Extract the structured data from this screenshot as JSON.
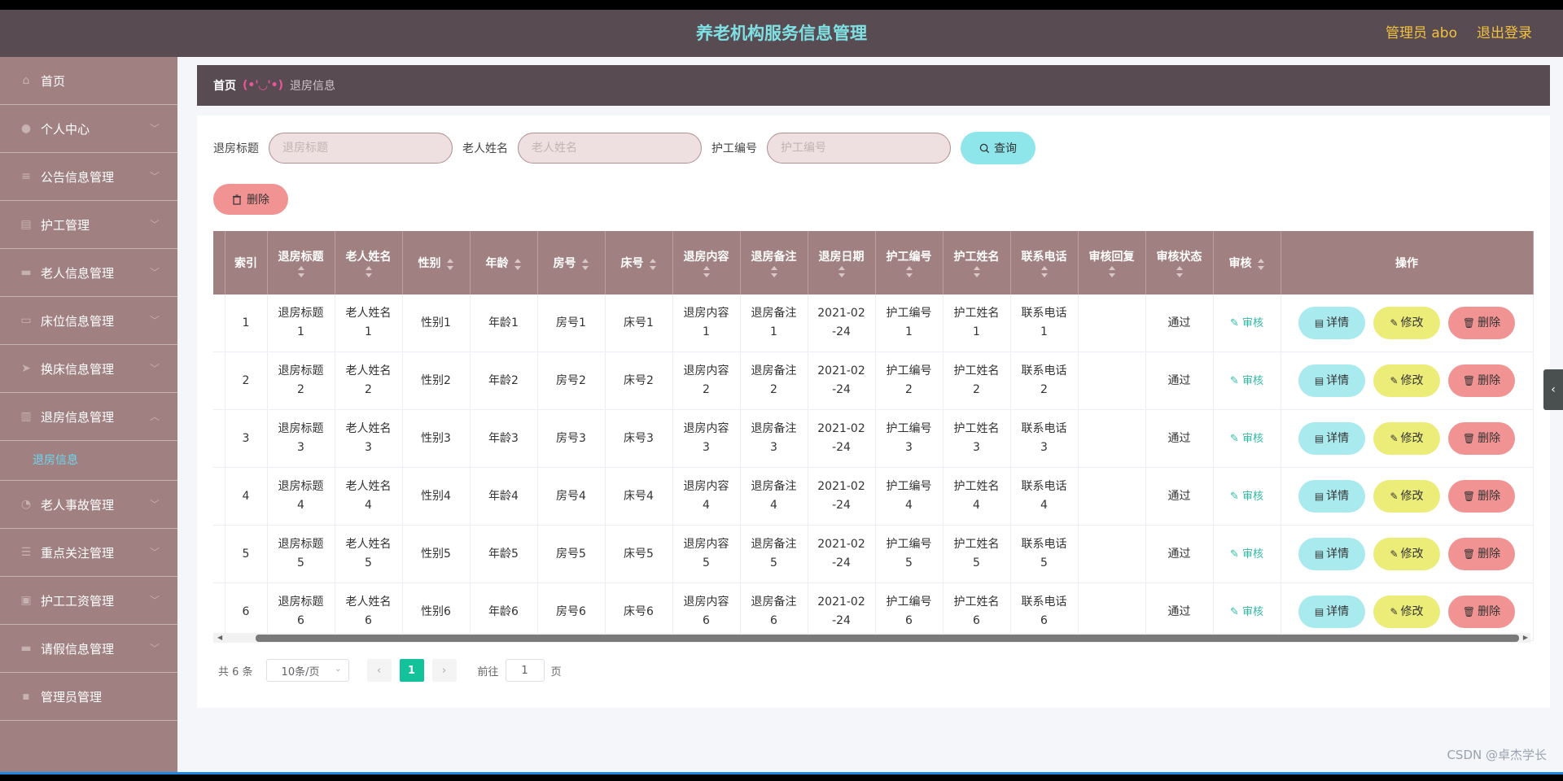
{
  "header": {
    "title": "养老机构服务信息管理",
    "user": "管理员 abo",
    "logout": "退出登录"
  },
  "sidebar": {
    "items": [
      {
        "label": "首页",
        "icon": "home-icon",
        "glyph": "⌂",
        "chevron": false
      },
      {
        "label": "个人中心",
        "icon": "user-icon",
        "glyph": "●",
        "chevron": true
      },
      {
        "label": "公告信息管理",
        "icon": "menu-icon",
        "glyph": "≡",
        "chevron": true
      },
      {
        "label": "护工管理",
        "icon": "list-icon",
        "glyph": "▤",
        "chevron": true
      },
      {
        "label": "老人信息管理",
        "icon": "message-icon",
        "glyph": "▬",
        "chevron": true
      },
      {
        "label": "床位信息管理",
        "icon": "bed-icon",
        "glyph": "▭",
        "chevron": true
      },
      {
        "label": "换床信息管理",
        "icon": "send-icon",
        "glyph": "➤",
        "chevron": true
      },
      {
        "label": "退房信息管理",
        "icon": "document-icon",
        "glyph": "▥",
        "chevron": true
      },
      {
        "label": "老人事故管理",
        "icon": "clock-icon",
        "glyph": "◔",
        "chevron": true
      },
      {
        "label": "重点关注管理",
        "icon": "filter-icon",
        "glyph": "☰",
        "chevron": true
      },
      {
        "label": "护工工资管理",
        "icon": "wallet-icon",
        "glyph": "▣",
        "chevron": true
      },
      {
        "label": "请假信息管理",
        "icon": "chat-icon",
        "glyph": "▬",
        "chevron": true
      },
      {
        "label": "管理员管理",
        "icon": "admin-icon",
        "glyph": "▪",
        "chevron": false
      }
    ],
    "submenu_label": "退房信息"
  },
  "breadcrumb": {
    "home": "首页",
    "sep": "(•'◡'•)",
    "current": "退房信息"
  },
  "search": {
    "f1_label": "退房标题",
    "f1_placeholder": "退房标题",
    "f2_label": "老人姓名",
    "f2_placeholder": "老人姓名",
    "f3_label": "护工编号",
    "f3_placeholder": "护工编号",
    "query_label": "查询"
  },
  "toolbar": {
    "delete_label": "删除"
  },
  "table": {
    "columns": [
      {
        "label": "索引",
        "sortable": false
      },
      {
        "label": "退房标题",
        "sortable": true
      },
      {
        "label": "老人姓名",
        "sortable": true
      },
      {
        "label": "性别",
        "sortable": true,
        "inline": true
      },
      {
        "label": "年龄",
        "sortable": true,
        "inline": true
      },
      {
        "label": "房号",
        "sortable": true,
        "inline": true
      },
      {
        "label": "床号",
        "sortable": true,
        "inline": true
      },
      {
        "label": "退房内容",
        "sortable": true
      },
      {
        "label": "退房备注",
        "sortable": true
      },
      {
        "label": "退房日期",
        "sortable": true
      },
      {
        "label": "护工编号",
        "sortable": true
      },
      {
        "label": "护工姓名",
        "sortable": true
      },
      {
        "label": "联系电话",
        "sortable": true
      },
      {
        "label": "审核回复",
        "sortable": true
      },
      {
        "label": "审核状态",
        "sortable": true
      },
      {
        "label": "审核",
        "sortable": true,
        "inline": true
      },
      {
        "label": "操作",
        "sortable": false
      }
    ],
    "rows": [
      {
        "index": "1",
        "title": [
          "退房标题",
          "1"
        ],
        "elder": [
          "老人姓名",
          "1"
        ],
        "gender": "性别1",
        "age": "年龄1",
        "room": "房号1",
        "bed": "床号1",
        "content": [
          "退房内容",
          "1"
        ],
        "remark": [
          "退房备注",
          "1"
        ],
        "date": [
          "2021-02",
          "-24"
        ],
        "wno": [
          "护工编号",
          "1"
        ],
        "wname": [
          "护工姓名",
          "1"
        ],
        "phone": [
          "联系电话",
          "1"
        ],
        "reply": "",
        "status": "通过"
      },
      {
        "index": "2",
        "title": [
          "退房标题",
          "2"
        ],
        "elder": [
          "老人姓名",
          "2"
        ],
        "gender": "性别2",
        "age": "年龄2",
        "room": "房号2",
        "bed": "床号2",
        "content": [
          "退房内容",
          "2"
        ],
        "remark": [
          "退房备注",
          "2"
        ],
        "date": [
          "2021-02",
          "-24"
        ],
        "wno": [
          "护工编号",
          "2"
        ],
        "wname": [
          "护工姓名",
          "2"
        ],
        "phone": [
          "联系电话",
          "2"
        ],
        "reply": "",
        "status": "通过"
      },
      {
        "index": "3",
        "title": [
          "退房标题",
          "3"
        ],
        "elder": [
          "老人姓名",
          "3"
        ],
        "gender": "性别3",
        "age": "年龄3",
        "room": "房号3",
        "bed": "床号3",
        "content": [
          "退房内容",
          "3"
        ],
        "remark": [
          "退房备注",
          "3"
        ],
        "date": [
          "2021-02",
          "-24"
        ],
        "wno": [
          "护工编号",
          "3"
        ],
        "wname": [
          "护工姓名",
          "3"
        ],
        "phone": [
          "联系电话",
          "3"
        ],
        "reply": "",
        "status": "通过"
      },
      {
        "index": "4",
        "title": [
          "退房标题",
          "4"
        ],
        "elder": [
          "老人姓名",
          "4"
        ],
        "gender": "性别4",
        "age": "年龄4",
        "room": "房号4",
        "bed": "床号4",
        "content": [
          "退房内容",
          "4"
        ],
        "remark": [
          "退房备注",
          "4"
        ],
        "date": [
          "2021-02",
          "-24"
        ],
        "wno": [
          "护工编号",
          "4"
        ],
        "wname": [
          "护工姓名",
          "4"
        ],
        "phone": [
          "联系电话",
          "4"
        ],
        "reply": "",
        "status": "通过"
      },
      {
        "index": "5",
        "title": [
          "退房标题",
          "5"
        ],
        "elder": [
          "老人姓名",
          "5"
        ],
        "gender": "性别5",
        "age": "年龄5",
        "room": "房号5",
        "bed": "床号5",
        "content": [
          "退房内容",
          "5"
        ],
        "remark": [
          "退房备注",
          "5"
        ],
        "date": [
          "2021-02",
          "-24"
        ],
        "wno": [
          "护工编号",
          "5"
        ],
        "wname": [
          "护工姓名",
          "5"
        ],
        "phone": [
          "联系电话",
          "5"
        ],
        "reply": "",
        "status": "通过"
      },
      {
        "index": "6",
        "title": [
          "退房标题",
          "6"
        ],
        "elder": [
          "老人姓名",
          "6"
        ],
        "gender": "性别6",
        "age": "年龄6",
        "room": "房号6",
        "bed": "床号6",
        "content": [
          "退房内容",
          "6"
        ],
        "remark": [
          "退房备注",
          "6"
        ],
        "date": [
          "2021-02",
          "-24"
        ],
        "wno": [
          "护工编号",
          "6"
        ],
        "wname": [
          "护工姓名",
          "6"
        ],
        "phone": [
          "联系电话",
          "6"
        ],
        "reply": "",
        "status": "通过"
      }
    ],
    "audit_label": "审核",
    "detail_label": "详情",
    "edit_label": "修改",
    "delete_label": "删除"
  },
  "pagination": {
    "total": "共 6 条",
    "page_size": "10条/页",
    "current": "1",
    "goto_prefix": "前往",
    "goto_value": "1",
    "goto_suffix": "页"
  },
  "watermark": "CSDN @卓杰学长",
  "colors": {
    "header_bg": "#584b52",
    "sidebar_bg": "#a08080",
    "title": "#7fe1e3",
    "accent_gold": "#f2c23f",
    "detail": "#a9eaee",
    "edit": "#ecec79",
    "delete": "#f29393",
    "page_active": "#13c29a"
  }
}
